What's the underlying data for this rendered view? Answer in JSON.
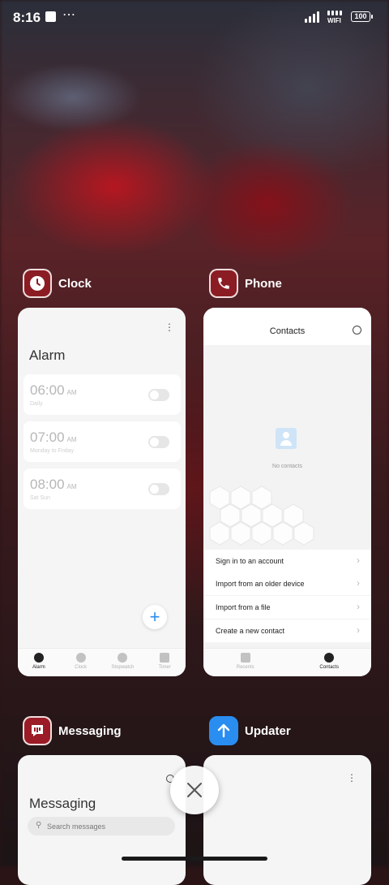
{
  "status_bar": {
    "time": "8:16",
    "wifi_label": "WIFI",
    "battery": "100",
    "icons": [
      "notification-square-icon",
      "more-dots-icon",
      "signal-icon",
      "wifi-icon",
      "battery-icon"
    ]
  },
  "apps": {
    "clock": {
      "name": "Clock",
      "icon": "clock-icon",
      "icon_color": "#8b1c24",
      "title": "Alarm",
      "alarms": [
        {
          "time": "06:00",
          "ampm": "AM",
          "repeat": "Daily",
          "enabled": false
        },
        {
          "time": "07:00",
          "ampm": "AM",
          "repeat": "Monday to Friday",
          "enabled": false
        },
        {
          "time": "08:00",
          "ampm": "AM",
          "repeat": "Sat Sun",
          "enabled": false
        }
      ],
      "fab": "+",
      "tabs": [
        {
          "label": "Alarm",
          "active": true
        },
        {
          "label": "Clock",
          "active": false
        },
        {
          "label": "Stopwatch",
          "active": false
        },
        {
          "label": "Timer",
          "active": false
        }
      ]
    },
    "phone": {
      "name": "Phone",
      "icon": "phone-icon",
      "icon_color": "#8b1c24",
      "title": "Contacts",
      "empty_text": "No contacts",
      "actions": [
        "Sign in to an account",
        "Import from an older device",
        "Import from a file",
        "Create a new contact"
      ],
      "tabs": [
        {
          "label": "Recents",
          "active": false
        },
        {
          "label": "Contacts",
          "active": true
        }
      ]
    },
    "messaging": {
      "name": "Messaging",
      "icon": "message-icon",
      "icon_color": "#9b1c26",
      "title": "Messaging",
      "search_placeholder": "Search messages"
    },
    "updater": {
      "name": "Updater",
      "icon": "arrow-up-icon",
      "icon_color": "#2a8df0"
    }
  },
  "close_button": "close-icon",
  "accent_color": "#2a8df0"
}
